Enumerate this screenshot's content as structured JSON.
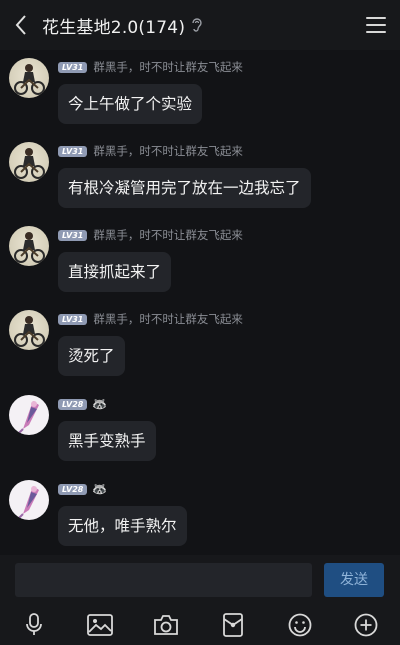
{
  "header": {
    "title": "花生基地2.0(174)"
  },
  "messages": [
    {
      "level": "LV31",
      "nickname": "群黑手，时不时让群友飞起来",
      "text": "今上午做了个实验",
      "avatar": "biker"
    },
    {
      "level": "LV31",
      "nickname": "群黑手，时不时让群友飞起来",
      "text": "有根冷凝管用完了放在一边我忘了",
      "avatar": "biker"
    },
    {
      "level": "LV31",
      "nickname": "群黑手，时不时让群友飞起来",
      "text": "直接抓起来了",
      "avatar": "biker"
    },
    {
      "level": "LV31",
      "nickname": "群黑手，时不时让群友飞起来",
      "text": "烫死了",
      "avatar": "biker"
    },
    {
      "level": "LV28",
      "nickname": "🦝",
      "text": "黑手变熟手",
      "avatar": "anime"
    },
    {
      "level": "LV28",
      "nickname": "🦝",
      "text": "无他，唯手熟尔",
      "avatar": "anime"
    }
  ],
  "composer": {
    "input_value": "",
    "send_label": "发送"
  },
  "toolbar": {
    "icons": [
      "microphone-icon",
      "image-icon",
      "camera-icon",
      "red-packet-icon",
      "emoji-icon",
      "plus-icon"
    ]
  },
  "colors": {
    "background": "#121316",
    "bubble": "#23252a",
    "send_button": "#1f4e82",
    "level_badge": "#8f9ab3"
  }
}
